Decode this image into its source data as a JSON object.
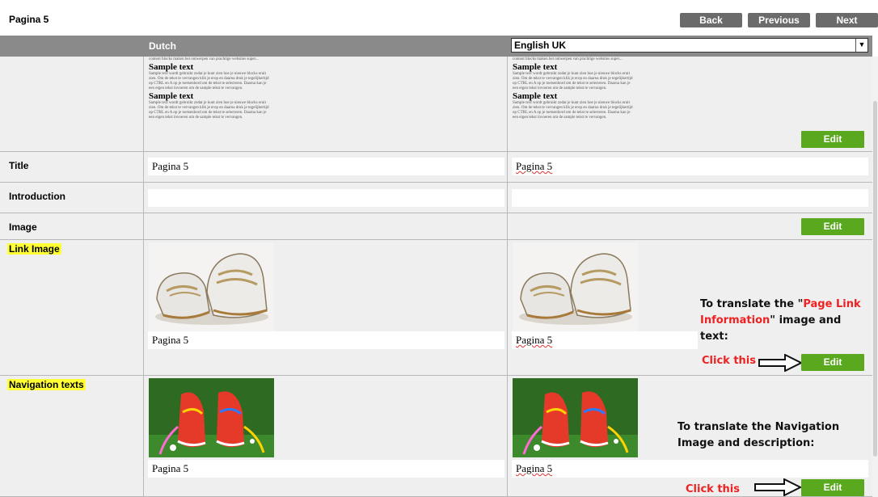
{
  "header": {
    "title": "Pagina 5",
    "back_label": "Back",
    "previous_label": "Previous",
    "next_label": "Next"
  },
  "languages": {
    "source": "Dutch",
    "target": "English UK"
  },
  "preview": {
    "intro_line": "content blocks maken het ontwerpen van prachtige websites super...",
    "heading": "Sample text",
    "body_line1": "Sample text wordt gebruikt zodat je kunt zien hoe je nieuwe blocks eruit",
    "body_line2": "zien. Om de tekst te vervangen klik je erop en daarna druk je tegelijkertijd",
    "body_line3": "op CTRL en A op je toetsenbord om de tekst te selecteren. Daarna kan je",
    "body_line4": "een eigen tekst invoeren om de sample tekst te vervangen."
  },
  "rows": {
    "title_label": "Title",
    "intro_label": "Introduction",
    "image_label": "Image",
    "link_image_label": "Link Image",
    "nav_texts_label": "Navigation texts",
    "title_nl": "Pagina 5",
    "title_en": "Pagina 5",
    "link_caption_nl": "Pagina 5",
    "link_caption_en": "Pagina 5",
    "nav_caption_nl": "Pagina 5",
    "nav_caption_en": "Pagina 5"
  },
  "buttons": {
    "edit_label": "Edit"
  },
  "annotations": {
    "link_pre": "To translate the \"",
    "link_red": "Page Link Information",
    "link_post": "\" image and text:",
    "nav_text": "To translate the Navigation Image and description:",
    "click_this": "Click this"
  },
  "colors": {
    "edit_green": "#5aa81e",
    "nav_gray": "#6b6b6b",
    "header_gray": "#8a8a8a",
    "highlight": "#ffff33",
    "annotation_red": "#e22222"
  }
}
